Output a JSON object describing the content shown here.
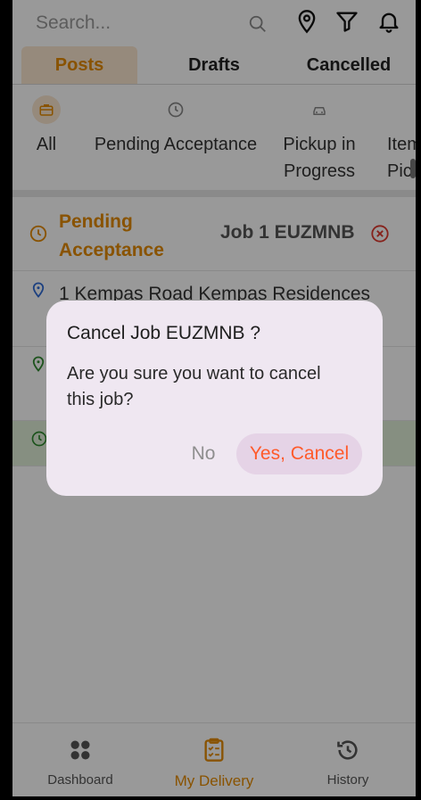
{
  "search": {
    "placeholder": "Search..."
  },
  "header_icons": [
    "location-pin-icon",
    "filter-icon",
    "bell-icon"
  ],
  "tabs": [
    {
      "label": "Posts",
      "active": true
    },
    {
      "label": "Drafts",
      "active": false
    },
    {
      "label": "Cancelled",
      "active": false
    }
  ],
  "categories": [
    {
      "label": "All",
      "icon": "briefcase-icon"
    },
    {
      "label": "Pending Acceptance",
      "icon": "clock-icon"
    },
    {
      "label": "Pickup in Progress",
      "icon": "car-icon"
    },
    {
      "label": "Item Picked",
      "icon": "location-icon"
    }
  ],
  "job": {
    "status": "Pending Acceptance",
    "id": "Job 1 EUZMNB",
    "address": "1 Kempas Road Kempas Residences"
  },
  "dialog": {
    "title": "Cancel Job EUZMNB ?",
    "message": "Are you sure you want to cancel this job?",
    "no_label": "No",
    "yes_label": "Yes, Cancel"
  },
  "bottom_nav": [
    {
      "label": "Dashboard",
      "icon": "grid-icon",
      "active": false
    },
    {
      "label": "My Delivery",
      "icon": "clipboard-icon",
      "active": true
    },
    {
      "label": "History",
      "icon": "history-icon",
      "active": false
    }
  ],
  "colors": {
    "accent": "#e58a00",
    "danger": "#ff5a2a",
    "dialog_bg": "#efe7f1"
  }
}
